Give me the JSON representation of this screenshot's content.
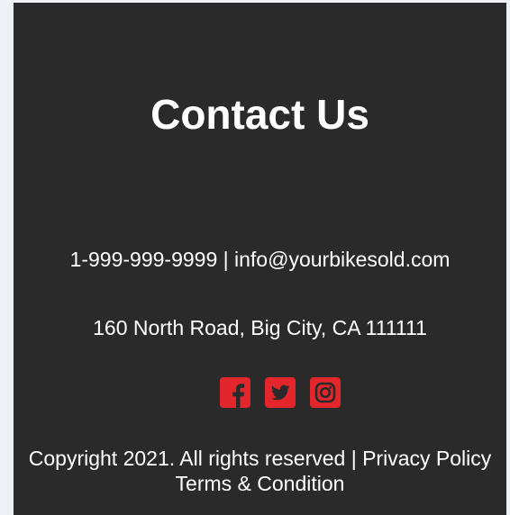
{
  "footer": {
    "title": "Contact Us",
    "phone": "1-999-999-9999",
    "separator": "|",
    "email": "info@yourbikesold.com",
    "address": "160 North Road, Big City, CA 111111",
    "social": [
      {
        "name": "facebook-icon"
      },
      {
        "name": "twitter-icon"
      },
      {
        "name": "instagram-icon"
      }
    ],
    "copyright": "Copyright 2021. All rights reserved",
    "privacy_label": "Privacy Policy",
    "terms_label": "Terms & Condition"
  },
  "colors": {
    "background": "#2a2a2a",
    "text": "#ffffff",
    "icon_accent": "#e3262b",
    "page": "#eef0f5"
  }
}
